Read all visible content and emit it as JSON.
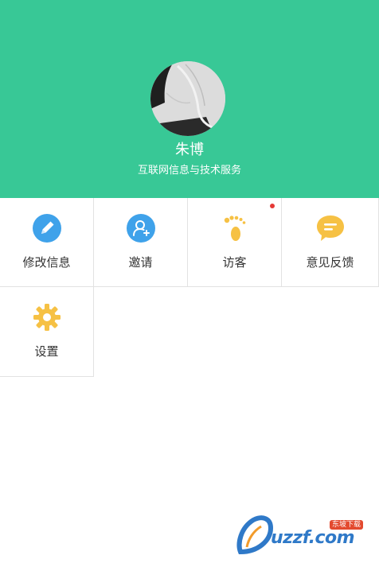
{
  "colors": {
    "header_bg": "#38c896",
    "edit_icon": "#3fa2ea",
    "invite_icon": "#3fa2ea",
    "visitor_icon": "#f6c144",
    "feedback_icon": "#f6c144",
    "settings_icon": "#f6c144",
    "badge": "#e53935"
  },
  "profile": {
    "name": "朱博",
    "org": "互联网信息与技术服务",
    "avatar_icon": "avatar-photo"
  },
  "menu": [
    {
      "label": "修改信息",
      "icon": "pencil-icon"
    },
    {
      "label": "邀请",
      "icon": "add-user-icon"
    },
    {
      "label": "访客",
      "icon": "footprint-icon",
      "has_badge": true
    },
    {
      "label": "意见反馈",
      "icon": "chat-bubble-icon"
    },
    {
      "label": "设置",
      "icon": "gear-icon"
    }
  ],
  "watermark": {
    "text": "uzzf.com",
    "tag": "东坡下载"
  }
}
